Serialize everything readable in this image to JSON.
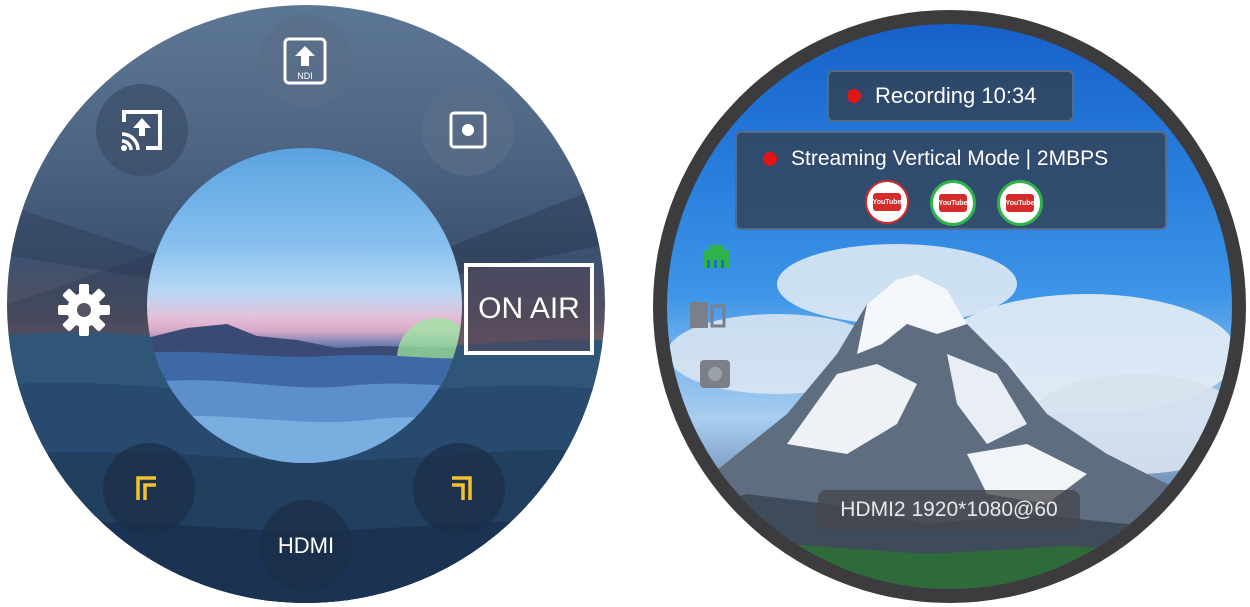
{
  "left_dial": {
    "buttons": {
      "ndi_label": "NDI",
      "hdmi_label": "HDMI"
    },
    "on_air_label": "ON AIR",
    "icons": [
      "ndi-upload-icon",
      "screen-cast-icon",
      "record-icon",
      "settings-gear-icon",
      "frame-corner-left-icon",
      "frame-corner-right-icon"
    ]
  },
  "viewfinder": {
    "recording": {
      "label": "Recording 10:34"
    },
    "streaming": {
      "label": "Streaming  Vertical Mode | 2MBPS"
    },
    "platforms": [
      "YouTube",
      "YouTube",
      "YouTube"
    ],
    "input_info": "HDMI2 1920*1080@60",
    "colors": {
      "record_dot": "#e01515",
      "ethernet": "#2fb34a"
    }
  }
}
